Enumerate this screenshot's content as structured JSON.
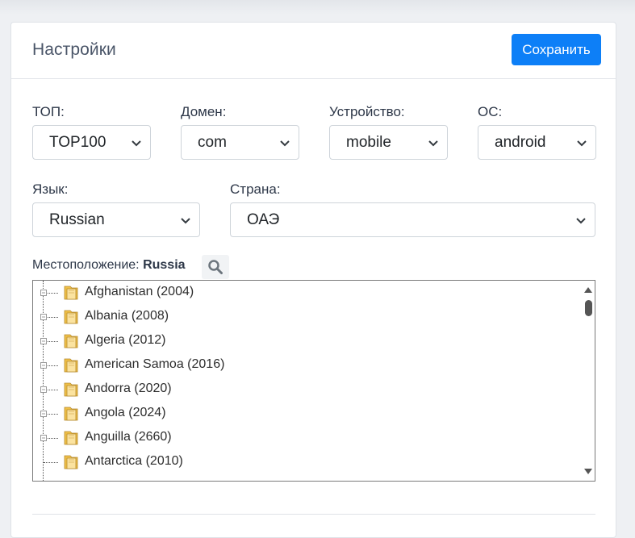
{
  "header": {
    "title": "Настройки",
    "save_label": "Сохранить"
  },
  "filters": {
    "top": {
      "label": "ТОП:",
      "value": "TOP100"
    },
    "domain": {
      "label": "Домен:",
      "value": "com"
    },
    "device": {
      "label": "Устройство:",
      "value": "mobile"
    },
    "os": {
      "label": "ОС:",
      "value": "android"
    },
    "language": {
      "label": "Язык:",
      "value": "Russian"
    },
    "country": {
      "label": "Страна:",
      "value": "ОАЭ"
    }
  },
  "location": {
    "label": "Местоположение:",
    "value": "Russia",
    "icon": "search-icon"
  },
  "tree": {
    "items": [
      {
        "label": "Afghanistan (2004)"
      },
      {
        "label": "Albania (2008)"
      },
      {
        "label": "Algeria (2012)"
      },
      {
        "label": "American Samoa (2016)"
      },
      {
        "label": "Andorra (2020)"
      },
      {
        "label": "Angola (2024)"
      },
      {
        "label": "Anguilla (2660)"
      },
      {
        "label": "Antarctica (2010)"
      }
    ]
  },
  "colors": {
    "accent": "#0d7ff7",
    "folder": "#f0c048"
  }
}
